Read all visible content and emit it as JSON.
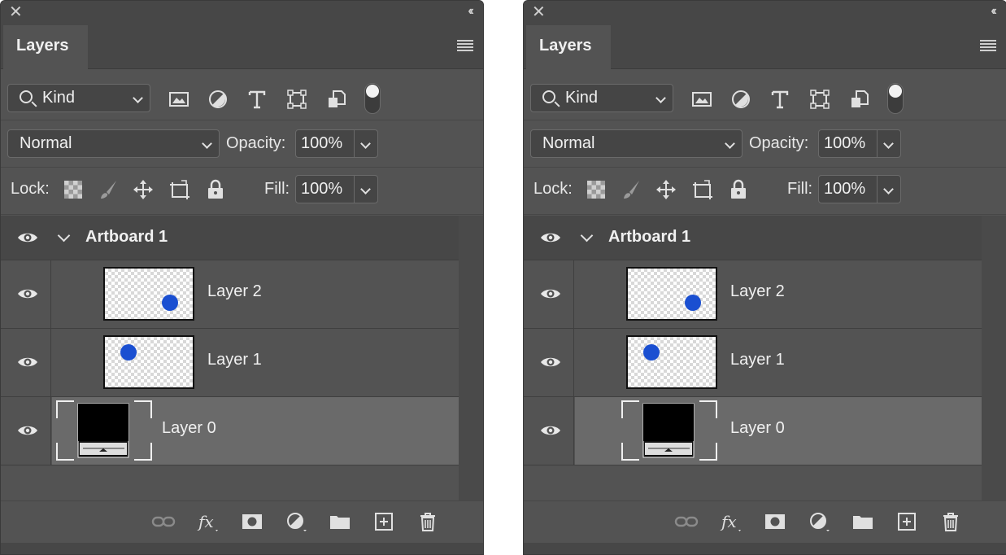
{
  "panels": [
    {
      "id": "left",
      "tab_title": "Layers",
      "filter": {
        "kind_label": "Kind"
      },
      "blend_mode": "Normal",
      "opacity_label": "Opacity:",
      "opacity_value": "100%",
      "lock_label": "Lock:",
      "fill_label": "Fill:",
      "fill_value": "100%",
      "artboard": {
        "name": "Artboard 1",
        "expanded": true
      },
      "layers": [
        {
          "name": "Layer 2",
          "dot": "bottom-right"
        },
        {
          "name": "Layer 1",
          "dot": "top-left"
        },
        {
          "name": "Layer 0",
          "selected": true
        }
      ]
    },
    {
      "id": "right",
      "tab_title": "Layers",
      "filter": {
        "kind_label": "Kind"
      },
      "blend_mode": "Normal",
      "opacity_label": "Opacity:",
      "opacity_value": "100%",
      "lock_label": "Lock:",
      "fill_label": "Fill:",
      "fill_value": "100%",
      "artboard": {
        "name": "Artboard 1",
        "expanded": true
      },
      "layers": [
        {
          "name": "Layer 2",
          "dot": "bottom-right"
        },
        {
          "name": "Layer 1",
          "dot": "top-left"
        },
        {
          "name": "Layer 0",
          "selected": true
        }
      ]
    }
  ],
  "icons": {
    "filter": [
      "image-filter-icon",
      "adjustment-filter-icon",
      "type-filter-icon",
      "shape-filter-icon",
      "smart-object-filter-icon"
    ],
    "lock": [
      "lock-transparent-pixels-icon",
      "lock-image-pixels-icon",
      "lock-position-icon",
      "lock-artboard-icon",
      "lock-all-icon"
    ],
    "footer": [
      "link-layers-icon",
      "fx-icon",
      "layer-mask-icon",
      "adjustment-layer-icon",
      "new-group-icon",
      "new-layer-icon",
      "delete-layer-icon"
    ]
  },
  "colors": {
    "panel_bg": "#535353",
    "header_bg": "#474747",
    "selected_row": "#6a6a6a",
    "dot_blue": "#1a4fd1"
  }
}
